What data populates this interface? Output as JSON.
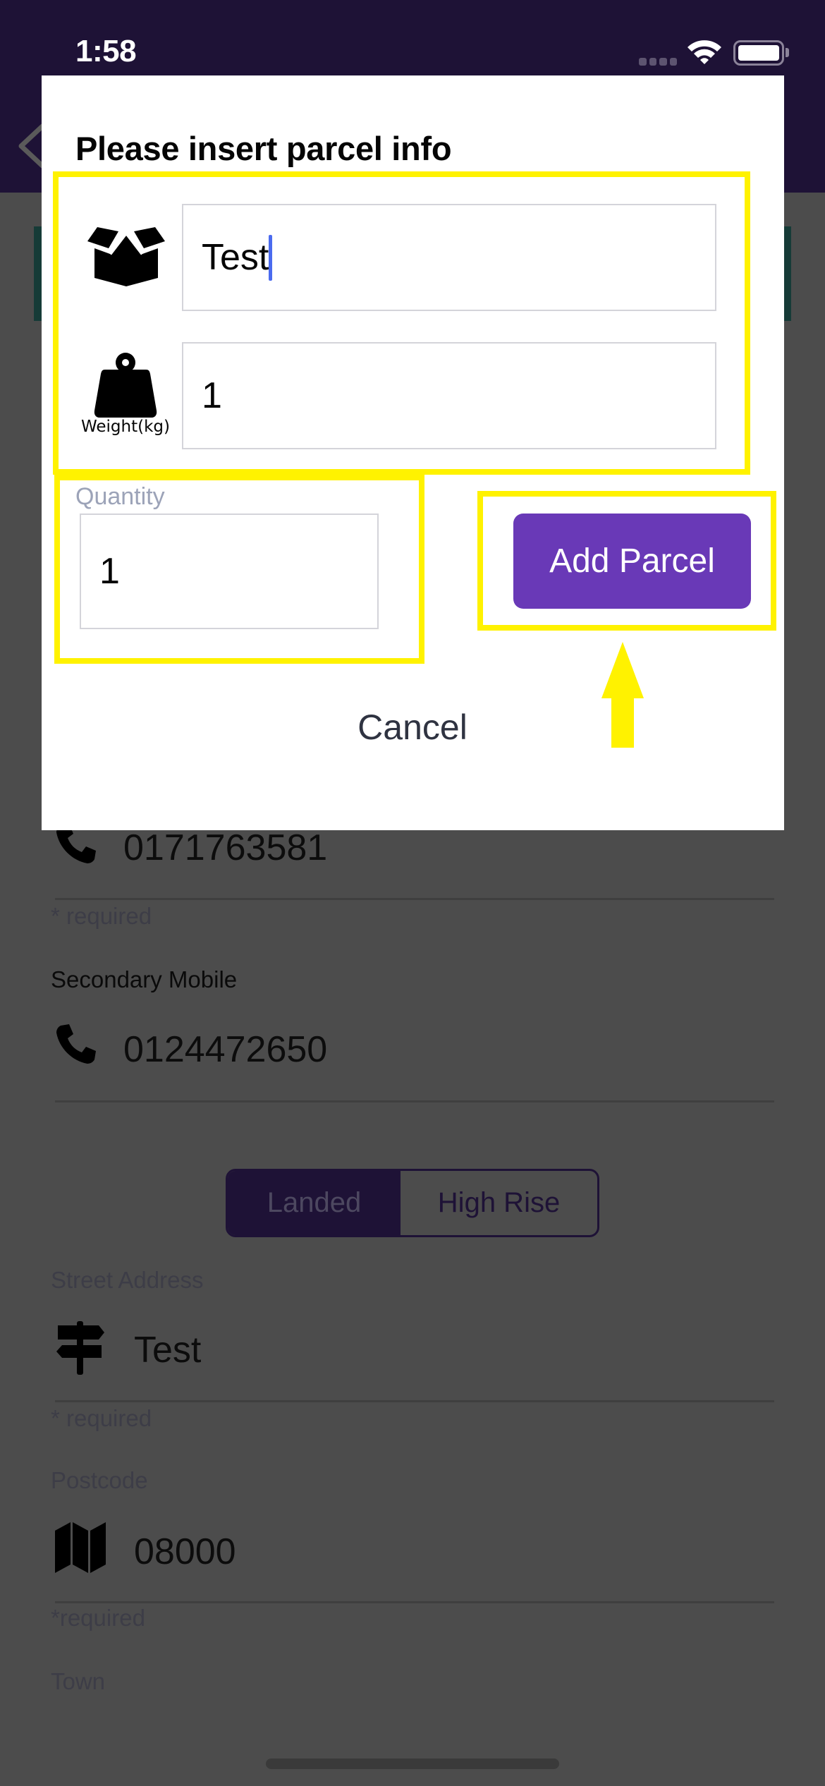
{
  "status_bar": {
    "time": "1:58",
    "wifi_icon": "wifi-icon",
    "battery_icon": "battery-icon",
    "signal_icon": "signal-dots-icon"
  },
  "nav": {
    "back_icon": "chevron-left-icon"
  },
  "background_form": {
    "primary_mobile": {
      "value": "0171763581",
      "icon": "phone-icon",
      "hint": "* required"
    },
    "secondary_mobile": {
      "label": "Secondary Mobile",
      "value": "0124472650",
      "icon": "phone-icon"
    },
    "building_type": {
      "options": [
        "Landed",
        "High Rise"
      ],
      "selected": "Landed"
    },
    "street_address": {
      "label": "Street Address",
      "value": "Test",
      "icon": "signpost-icon",
      "hint": "* required"
    },
    "postcode": {
      "label": "Postcode",
      "value": "08000",
      "icon": "map-icon",
      "hint": "*required"
    },
    "town": {
      "label": "Town"
    }
  },
  "modal": {
    "title": "Please insert parcel info",
    "parcel_name": {
      "value": "Test",
      "icon": "open-box-icon"
    },
    "weight": {
      "value": "1",
      "icon": "weight-icon",
      "label": "Weight(kg)"
    },
    "quantity": {
      "label": "Quantity",
      "value": "1"
    },
    "add_button": "Add Parcel",
    "cancel_button": "Cancel"
  },
  "annotations": {
    "highlight_color": "#fff200",
    "arrow_target": "Add Parcel"
  },
  "colors": {
    "header": "#1e1236",
    "accent_button": "#6939b7",
    "overlay_background": "#4c4c4c",
    "teal_banner": "#163b37",
    "cursor": "#4b6bef"
  }
}
